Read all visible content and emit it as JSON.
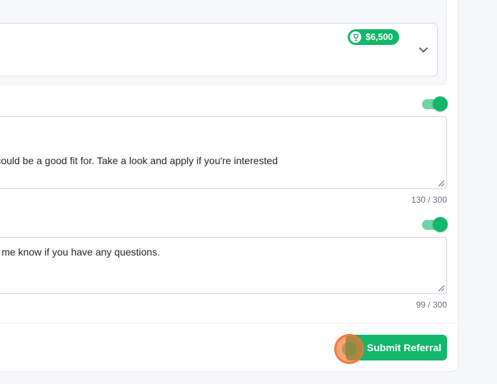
{
  "job_select": {
    "bounty": "$6,500",
    "bounty_icon": "trophy-icon",
    "chevron_icon": "chevron-down-icon"
  },
  "intro_message": {
    "enabled": true,
    "text": "could be a good fit for. Take a look and apply if you're interested",
    "counter": "130 / 300"
  },
  "closing_message": {
    "enabled": true,
    "text": "Let me know if you have any questions.",
    "counter": "99 / 300"
  },
  "actions": {
    "submit_label": "Submit Referral"
  },
  "colors": {
    "accent": "#12b76a",
    "accent_light": "#6fd3a3",
    "cursor": "#f67130"
  }
}
